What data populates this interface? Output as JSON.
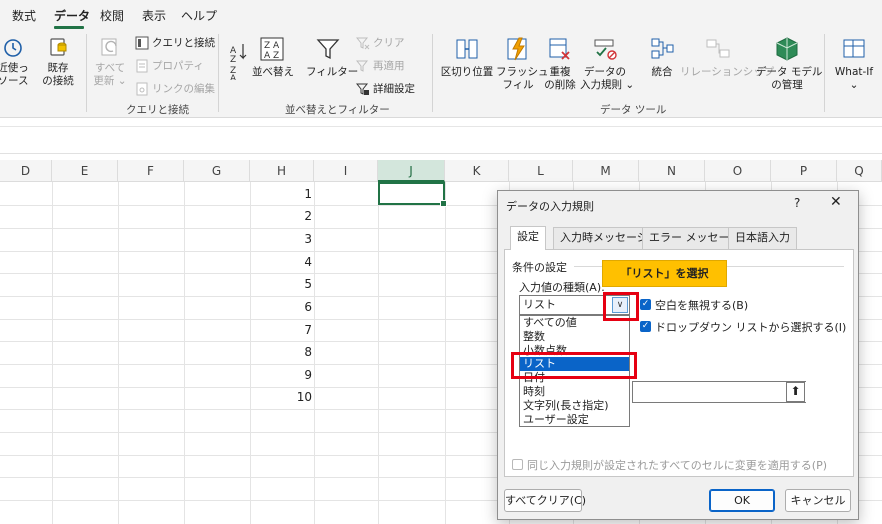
{
  "ribbon_tabs": [
    "数式",
    "データ",
    "校閲",
    "表示",
    "ヘルプ"
  ],
  "ribbon": {
    "get_data": {
      "recent_sources_line1": "近使っ",
      "recent_sources_line2": "ソース",
      "existing_line1": "既存",
      "existing_line2": "の接続"
    },
    "queries": {
      "refresh_line1": "すべて",
      "refresh_line2": "更新",
      "queries_connections": "クエリと接続",
      "properties": "プロパティ",
      "edit_links": "リンクの編集",
      "group_label": "クエリと接続"
    },
    "sort_filter": {
      "sort": "並べ替え",
      "filter": "フィルター",
      "clear": "クリア",
      "reapply": "再適用",
      "advanced": "詳細設定",
      "group_label": "並べ替えとフィルター"
    },
    "data_tools": {
      "text_to_columns": "区切り位置",
      "flash_fill_line1": "フラッシュ",
      "flash_fill_line2": "フィル",
      "remove_dup_line1": "重複",
      "remove_dup_line2": "の削除",
      "validation_line1": "データの",
      "validation_line2": "入力規則",
      "consolidate": "統合",
      "relationships": "リレーションシップ",
      "data_model_line1": "データ モデル",
      "data_model_line2": "の管理",
      "group_label": "データ ツール"
    },
    "forecast": {
      "what_if": "What-If"
    }
  },
  "grid": {
    "columns": [
      "D",
      "E",
      "F",
      "G",
      "H",
      "I",
      "J",
      "K",
      "L",
      "M",
      "N",
      "O",
      "P",
      "Q"
    ],
    "selected_column": "J",
    "h_values": [
      "1",
      "2",
      "3",
      "4",
      "5",
      "6",
      "7",
      "8",
      "9",
      "10"
    ]
  },
  "dialog": {
    "title": "データの入力規則",
    "help": "?",
    "close": "✕",
    "tabs": [
      "設定",
      "入力時メッセージ",
      "エラー メッセージ",
      "日本語入力"
    ],
    "criteria_label": "条件の設定",
    "allow_label": "入力値の種類(A):",
    "allow_value": "リスト",
    "allow_options": [
      "すべての値",
      "整数",
      "小数点数",
      "リスト",
      "日付",
      "時刻",
      "文字列(長さ指定)",
      "ユーザー設定"
    ],
    "selected_option": "リスト",
    "ignore_blank": "空白を無視する(B)",
    "in_cell_dropdown": "ドロップダウン リストから選択する(I)",
    "apply_all": "同じ入力規則が設定されたすべてのセルに変更を適用する(P)",
    "clear_all": "すべてクリア(C)",
    "ok": "OK",
    "cancel": "キャンセル"
  },
  "annotation": {
    "callout_text": "「リスト」を選択",
    "callout_color": "#ffc000",
    "highlight_color": "#e60012"
  }
}
